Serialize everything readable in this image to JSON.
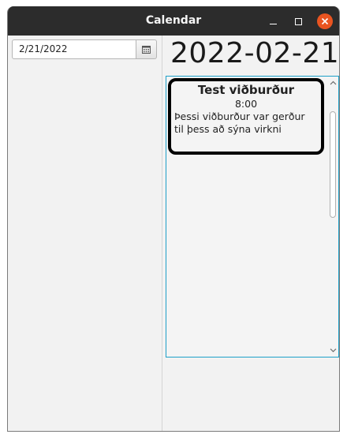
{
  "window": {
    "title": "Calendar",
    "controls": {
      "minimize_icon": "minimize-icon",
      "maximize_icon": "maximize-icon",
      "close_icon": "close-icon",
      "close_color": "#e95420"
    }
  },
  "date_picker": {
    "value": "2/21/2022",
    "button_icon": "calendar-icon"
  },
  "day_view": {
    "heading": "2022-02-21",
    "events": [
      {
        "title": "Test viðburður",
        "time": "8:00",
        "description": "Þessi viðburður var gerður til þess að sýna virkni"
      }
    ]
  },
  "colors": {
    "titlebar": "#2c2c2c",
    "list_focus_border": "#1ea0c8",
    "event_border": "#000000"
  }
}
